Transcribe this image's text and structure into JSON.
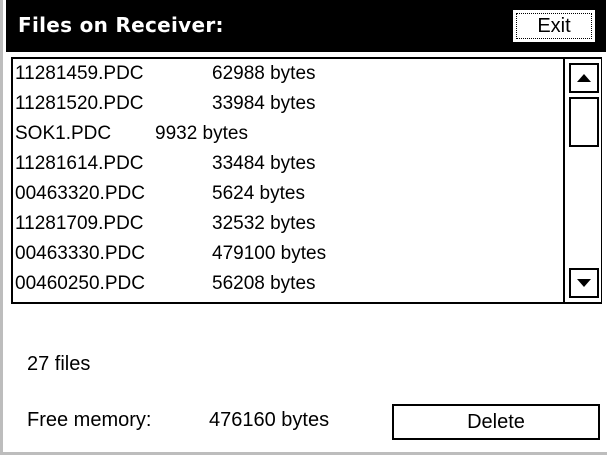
{
  "header": {
    "title": "Files on Receiver:",
    "exit_label": "Exit"
  },
  "files": [
    {
      "name": "11281459.PDC",
      "size": "62988 bytes"
    },
    {
      "name": "11281520.PDC",
      "size": "33984 bytes"
    },
    {
      "name": "SOK1.PDC",
      "size": "9932 bytes"
    },
    {
      "name": "11281614.PDC",
      "size": "33484 bytes"
    },
    {
      "name": "00463320.PDC",
      "size": "5624 bytes"
    },
    {
      "name": "11281709.PDC",
      "size": "32532 bytes"
    },
    {
      "name": "00463330.PDC",
      "size": "479100 bytes"
    },
    {
      "name": "00460250.PDC",
      "size": "56208 bytes"
    }
  ],
  "footer": {
    "file_count": "27 files",
    "free_memory_label": "Free memory:",
    "free_memory_value": "476160 bytes",
    "delete_label": "Delete"
  },
  "icons": {
    "scroll_up": "triangle-up-icon",
    "scroll_down": "triangle-down-icon"
  }
}
